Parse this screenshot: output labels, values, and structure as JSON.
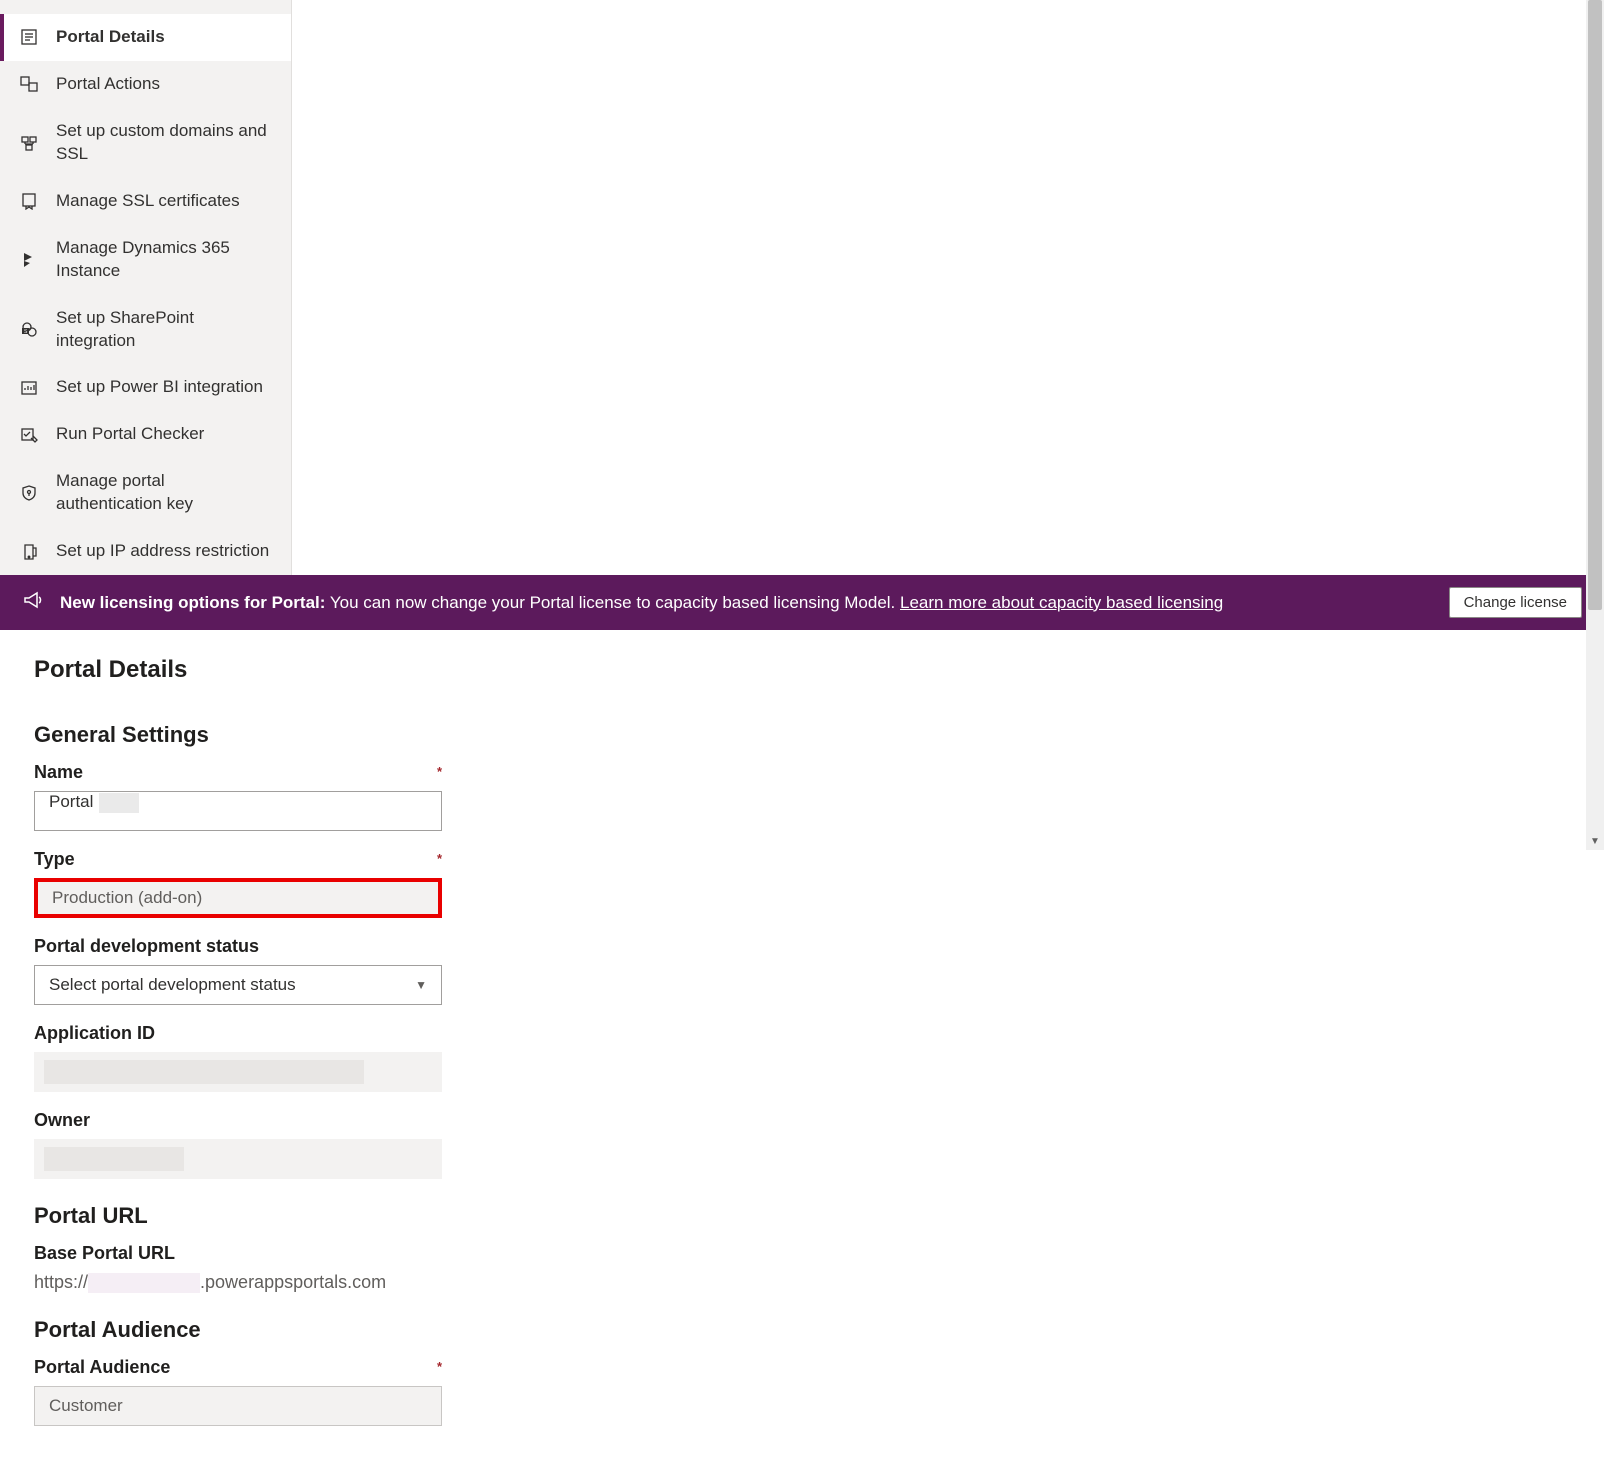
{
  "banner": {
    "bold": "New licensing options for Portal:",
    "text": " You can now change your Portal license to capacity based licensing Model. ",
    "link": "Learn more about capacity based licensing",
    "button": "Change license"
  },
  "sidebar": {
    "items": [
      {
        "label": "Portal Details"
      },
      {
        "label": "Portal Actions"
      },
      {
        "label": "Set up custom domains and SSL"
      },
      {
        "label": "Manage SSL certificates"
      },
      {
        "label": "Manage Dynamics 365 Instance"
      },
      {
        "label": "Set up SharePoint integration"
      },
      {
        "label": "Set up Power BI integration"
      },
      {
        "label": "Run Portal Checker"
      },
      {
        "label": "Manage portal authentication key"
      },
      {
        "label": "Set up IP address restriction"
      }
    ]
  },
  "page": {
    "title": "Portal Details",
    "general_settings_title": "General Settings",
    "name_label": "Name",
    "name_value": "Portal",
    "type_label": "Type",
    "type_value": "Production (add-on)",
    "dev_status_label": "Portal development status",
    "dev_status_placeholder": "Select portal development status",
    "app_id_label": "Application ID",
    "owner_label": "Owner",
    "portal_url_title": "Portal URL",
    "base_url_label": "Base Portal URL",
    "base_url_prefix": "https://",
    "base_url_suffix": ".powerappsportals.com",
    "audience_title": "Portal Audience",
    "audience_label": "Portal Audience",
    "audience_value": "Customer"
  }
}
